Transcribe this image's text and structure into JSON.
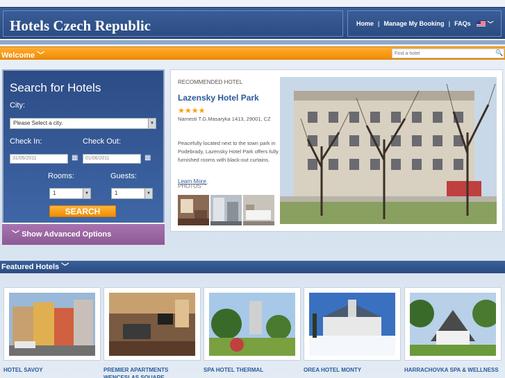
{
  "header": {
    "site_title": "Hotels Czech Republic",
    "nav": {
      "home": "Home",
      "sep1": "|",
      "manage": "Manage My Booking",
      "sep2": "|",
      "faqs": "FAQs"
    }
  },
  "welcome_bar": {
    "title": "Welcome",
    "search_placeholder": "Find a hotel"
  },
  "search": {
    "title": "Search for Hotels",
    "city_label": "City:",
    "city_value": "Please Select a city.",
    "checkin_label": "Check In:",
    "checkout_label": "Check Out:",
    "checkin_value": "31/05/2011",
    "checkout_value": "01/06/2011",
    "rooms_label": "Rooms:",
    "guests_label": "Guests:",
    "rooms_value": "1",
    "guests_value": "1",
    "button": "SEARCH",
    "advanced": "Show Advanced Options"
  },
  "recommended": {
    "label": "RECOMMENDED HOTEL",
    "name": "Lazensky Hotel Park",
    "stars": "★★★★",
    "rating": 4,
    "address": "Namesti T.G.Masaryka 1413, 29001, CZ",
    "description": "Peacefully located next to the town park in Podebrady, Lazensky Hotel Park offers fully furnished rooms with black-out curtains.",
    "learn_more": "Learn More",
    "photos_label": "PHOTOS"
  },
  "featured": {
    "title": "Featured Hotels",
    "hotels": [
      {
        "name": "HOTEL SAVOY"
      },
      {
        "name": "PREMIER APARTMENTS WENCESLAS SQUARE"
      },
      {
        "name": "SPA HOTEL THERMAL"
      },
      {
        "name": "OREA HOTEL MONTY"
      },
      {
        "name": "HARRACHOVKA SPA & WELLNESS"
      }
    ]
  },
  "colors": {
    "navy": "#2b4b80",
    "orange": "#f08c00",
    "purple": "#8c5a95",
    "link": "#2a5a9a"
  }
}
